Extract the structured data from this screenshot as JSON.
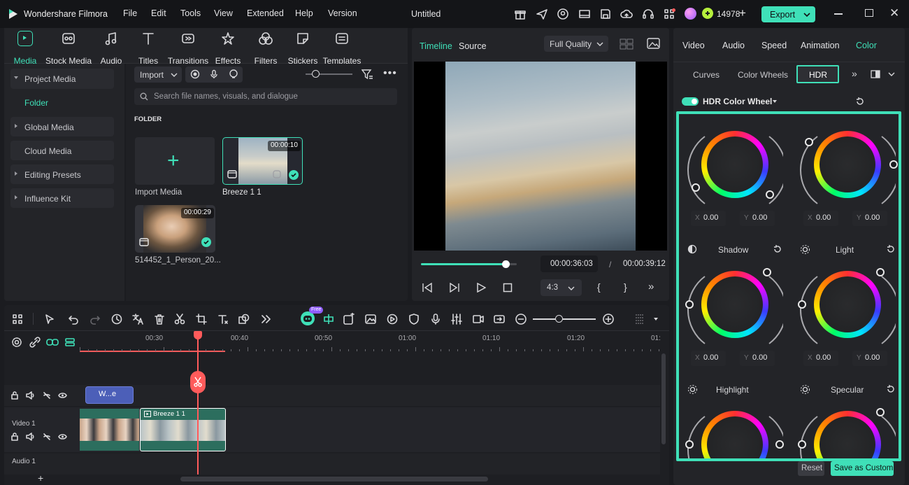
{
  "app": {
    "name": "Wondershare Filmora",
    "project_title": "Untitled",
    "credits": "14978",
    "export_label": "Export"
  },
  "menu": [
    "File",
    "Edit",
    "Tools",
    "View",
    "Extended",
    "Help",
    "Version"
  ],
  "categories": [
    {
      "label": "Media",
      "icon": "media-icon"
    },
    {
      "label": "Stock Media",
      "icon": "stock-media-icon"
    },
    {
      "label": "Audio",
      "icon": "music-note-icon"
    },
    {
      "label": "Titles",
      "icon": "titles-icon"
    },
    {
      "label": "Transitions",
      "icon": "transitions-icon"
    },
    {
      "label": "Effects",
      "icon": "effects-icon"
    },
    {
      "label": "Filters",
      "icon": "filters-icon"
    },
    {
      "label": "Stickers",
      "icon": "stickers-icon"
    },
    {
      "label": "Templates",
      "icon": "templates-icon"
    }
  ],
  "sidebar": {
    "project_media": "Project Media",
    "folder": "Folder",
    "global_media": "Global Media",
    "cloud_media": "Cloud Media",
    "editing_presets": "Editing Presets",
    "influence_kit": "Influence Kit"
  },
  "media": {
    "import_label": "Import",
    "search_placeholder": "Search file names, visuals, and dialogue",
    "folder_header": "FOLDER",
    "import_media_label": "Import Media",
    "items": [
      {
        "name": "Breeze 1 1",
        "duration": "00:00:10"
      },
      {
        "name": "514452_1_Person_20...",
        "duration": "00:00:29"
      }
    ]
  },
  "preview": {
    "tab_timeline": "Timeline",
    "tab_source": "Source",
    "quality": "Full Quality",
    "current_time": "00:00:36:03",
    "separator": "/",
    "total_time": "00:00:39:12",
    "aspect": "4:3",
    "progress": 0.88
  },
  "right_panel": {
    "tabs": [
      "Video",
      "Audio",
      "Speed",
      "Animation",
      "Color"
    ],
    "subtabs": [
      "Curves",
      "Color Wheels",
      "HDR"
    ],
    "hdr_title": "HDR Color Wheel",
    "wheels": [
      {
        "label": "",
        "x": "0.00",
        "y": "0.00"
      },
      {
        "label": "",
        "x": "0.00",
        "y": "0.00"
      },
      {
        "label": "Shadow",
        "x": "0.00",
        "y": "0.00"
      },
      {
        "label": "Light",
        "x": "0.00",
        "y": "0.00"
      },
      {
        "label": "Highlight",
        "x": "",
        "y": ""
      },
      {
        "label": "Specular",
        "x": "",
        "y": ""
      }
    ],
    "x_label": "X",
    "y_label": "Y",
    "reset_label": "Reset",
    "save_custom_label": "Save as Custom"
  },
  "timeline": {
    "ruler": [
      "00:30",
      "00:40",
      "00:50",
      "01:00",
      "01:10",
      "01:20",
      "01:"
    ],
    "title_clip": "W...e",
    "video_clip": "Breeze 1 1",
    "track_video": "Video 1",
    "track_audio": "Audio 1",
    "ai_badge": "Free"
  },
  "colors": {
    "accent": "#3fe0b8",
    "export_bg": "#3fe0b8",
    "playhead": "#ff5b5b",
    "title_clip": "#4c5fb8"
  }
}
